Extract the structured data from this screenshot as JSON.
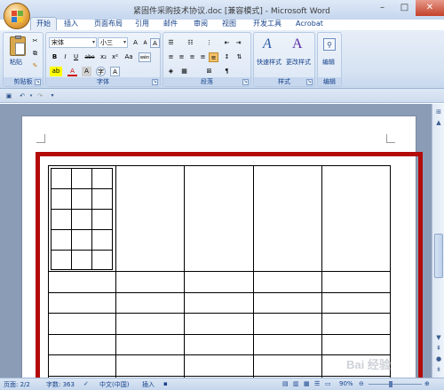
{
  "window": {
    "title": "紧固件采购技术协议.doc [兼容模式] - Microsoft Word",
    "min": "–",
    "max": "□",
    "close": "✕"
  },
  "tabs": [
    "开始",
    "插入",
    "页面布局",
    "引用",
    "邮件",
    "审阅",
    "视图",
    "开发工具",
    "Acrobat"
  ],
  "ribbon": {
    "clipboard": {
      "label": "剪贴板",
      "paste": "粘贴"
    },
    "font": {
      "label": "字体",
      "name": "宋体",
      "size": "小三",
      "bold": "B",
      "italic": "I",
      "underline": "U",
      "strike": "abe",
      "subscript": "x₂",
      "superscript": "x²",
      "changecase": "Aa",
      "grow": "A",
      "shrink": "A",
      "clear": "A",
      "phonetic": "wén",
      "charborder": "A",
      "charshade": "A",
      "enclose": "字",
      "highlight": "ab",
      "fontcolor": "A"
    },
    "paragraph": {
      "label": "段落"
    },
    "styles": {
      "label": "样式",
      "quick": "快速样式",
      "change": "更改样式"
    },
    "editing": {
      "label": "编辑",
      "btn": "编辑"
    }
  },
  "status": {
    "page": "页面: 2/2",
    "words": "字数: 363",
    "lang": "中文(中国)",
    "insert": "插入",
    "zoom": "90%"
  },
  "watermark": "Bai 经验"
}
